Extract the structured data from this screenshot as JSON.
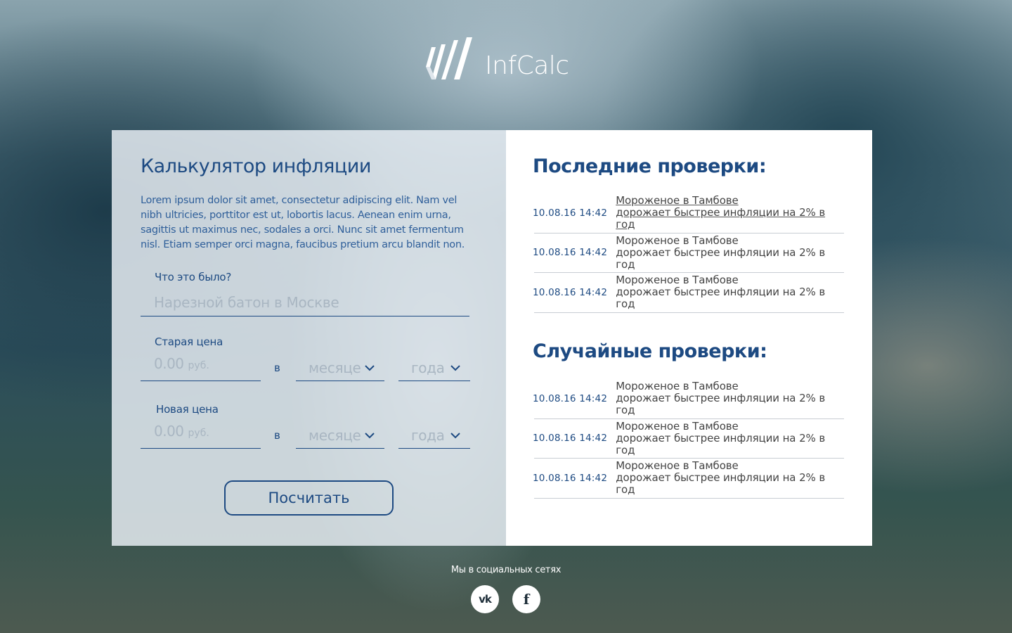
{
  "brand": {
    "name": "InfCalc"
  },
  "calculator": {
    "title": "Калькулятор инфляции",
    "description": "Lorem ipsum dolor sit amet, consectetur adipiscing elit. Nam vel nibh ultricies, porttitor est ut, lobortis lacus. Aenean enim urna, sagittis ut maximus nec, sodales a orci. Nunc sit amet fermentum nisl. Etiam semper orci magna, faucibus pretium arcu blandit non.",
    "what_label": "Что это было?",
    "what_placeholder": "Нарезной батон в Москве",
    "old_price": {
      "label": "Старая цена",
      "value_placeholder": "0.00",
      "unit": "руб.",
      "in_word": "в",
      "month_placeholder": "месяце",
      "year_placeholder": "года"
    },
    "new_price": {
      "label": "Новая цена",
      "value_placeholder": "0.00",
      "unit": "руб.",
      "in_word": "в",
      "month_placeholder": "месяце",
      "year_placeholder": "года"
    },
    "submit_label": "Посчитать"
  },
  "recent": {
    "title": "Последние проверки:",
    "items": [
      {
        "date": "10.08.16 14:42",
        "line1": "Мороженое в Тамбове",
        "line2": "дорожает быстрее инфляции на 2% в год"
      },
      {
        "date": "10.08.16 14:42",
        "line1": "Мороженое в Тамбове",
        "line2": "дорожает быстрее инфляции на 2% в год"
      },
      {
        "date": "10.08.16 14:42",
        "line1": "Мороженое в Тамбове",
        "line2": "дорожает быстрее инфляции на 2% в год"
      }
    ]
  },
  "random": {
    "title": "Случайные проверки:",
    "items": [
      {
        "date": "10.08.16 14:42",
        "line1": "Мороженое в Тамбове",
        "line2": "дорожает быстрее инфляции на 2% в год"
      },
      {
        "date": "10.08.16 14:42",
        "line1": "Мороженое в Тамбове",
        "line2": "дорожает быстрее инфляции на 2% в год"
      },
      {
        "date": "10.08.16 14:42",
        "line1": "Мороженое в Тамбове",
        "line2": "дорожает быстрее инфляции на 2% в год"
      }
    ]
  },
  "social": {
    "label": "Мы в социальных сетях",
    "networks": [
      {
        "icon": "vk-icon",
        "glyph": "vk"
      },
      {
        "icon": "facebook-icon",
        "glyph": "f"
      }
    ]
  },
  "colors": {
    "accent": "#1d4a82",
    "placeholder": "#a9b6c2"
  }
}
